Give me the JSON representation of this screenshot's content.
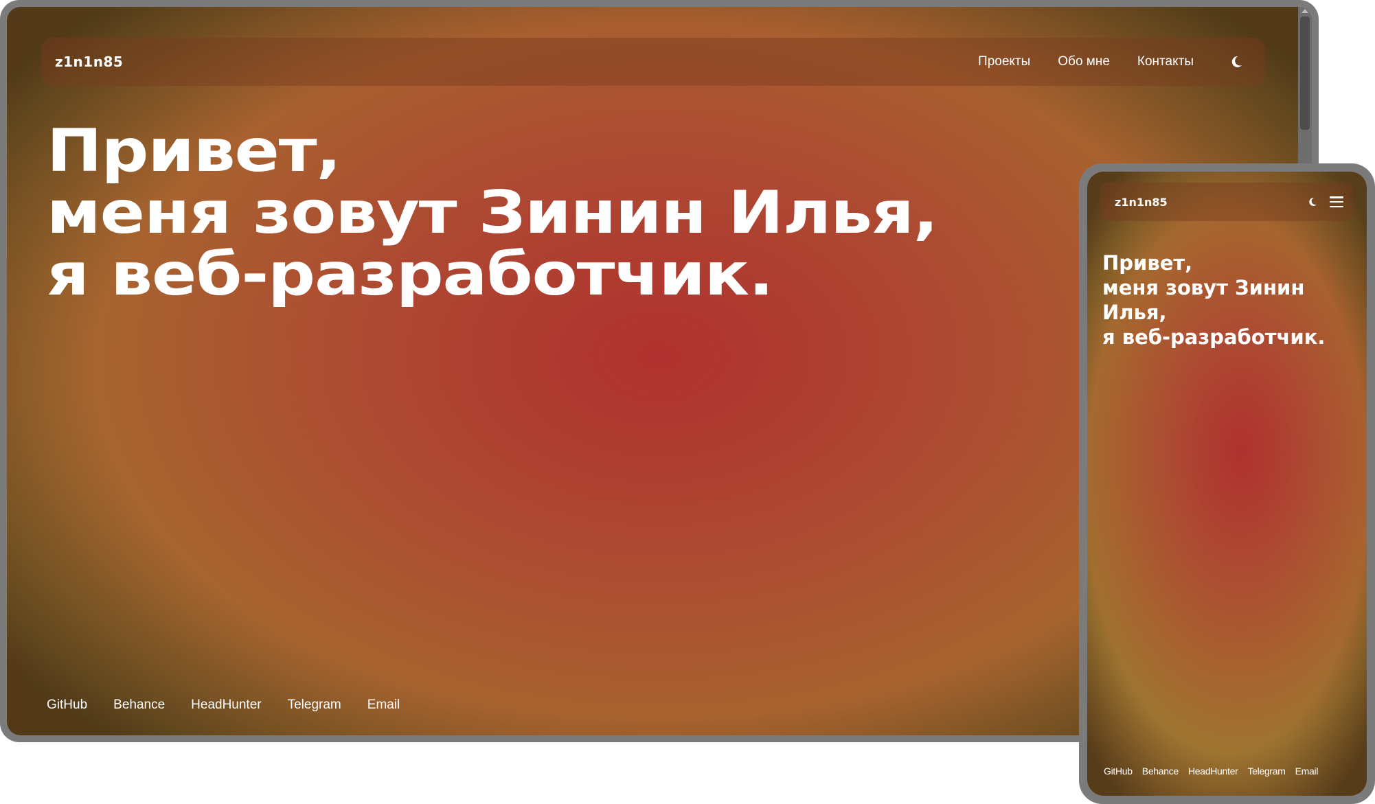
{
  "desktop": {
    "logo": "z1n1n85",
    "nav": {
      "projects": "Проекты",
      "about": "Обо мне",
      "contacts": "Контакты"
    },
    "theme_toggle_icon": "moon-icon",
    "hero": {
      "line1": "Привет,",
      "line2": "меня зовут Зинин Илья,",
      "line3": "я веб-разработчик."
    },
    "social": [
      "GitHub",
      "Behance",
      "HeadHunter",
      "Telegram",
      "Email"
    ]
  },
  "mobile": {
    "logo": "z1n1n85",
    "theme_toggle_icon": "moon-icon",
    "menu_icon": "menu-icon",
    "hero": {
      "line1": "Привет,",
      "line2": "меня зовут Зинин",
      "line3": "Илья,",
      "line4": "я веб-разработчик."
    },
    "social": [
      "GitHub",
      "Behance",
      "HeadHunter",
      "Telegram",
      "Email"
    ]
  },
  "colors": {
    "frame": "#7b7b7b",
    "gradient_center": "#b0312f",
    "gradient_edge": "#9e7430",
    "text": "#ffffff"
  }
}
